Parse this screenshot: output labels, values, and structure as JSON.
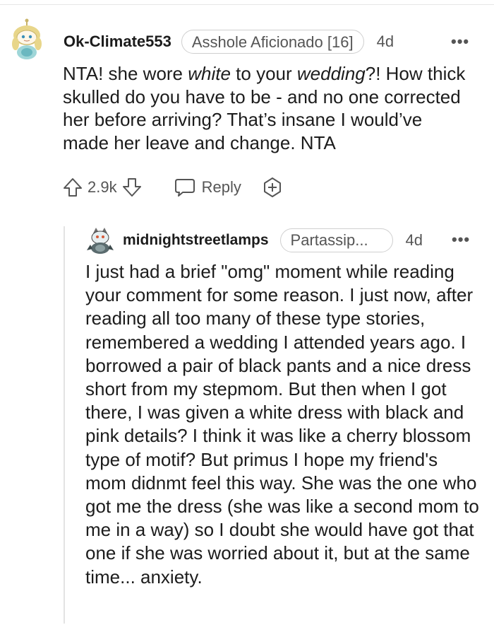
{
  "parent_comment": {
    "username": "Ok-Climate553",
    "flair": "Asshole Aficionado [16]",
    "age": "4d",
    "more_label": "•••",
    "body": {
      "p1": "NTA! she wore ",
      "em1": "white",
      "p2": " to your ",
      "em2": "wedding",
      "p3": "?! How thick skulled do you have to be - and no one corrected her before arriving? That’s insane I would’ve made her leave and change. NTA"
    },
    "score": "2.9k",
    "reply_label": "Reply"
  },
  "reply_comment": {
    "username": "midnightstreetlamps",
    "flair": "Partassip...",
    "age": "4d",
    "more_label": "•••",
    "body": "I just had a brief \"omg\" moment while reading your comment for some reason. I just now, after reading all too many of these type stories, remembered a wedding I attended years ago. I borrowed a pair of black pants and a nice dress short from my stepmom. But then when I got there, I was given a white dress with black and pink details? I think it was like a cherry blossom type of motif? But primus I hope my friend's mom didnmt feel this way. She was the one who got me the dress (she was like a second mom to me in a way) so I doubt she would have got that one if she was worried about it, but at the same time... anxiety."
  },
  "icons": {
    "upvote": "upvote-arrow-icon",
    "downvote": "downvote-arrow-icon",
    "reply": "speech-bubble-icon",
    "award": "award-plus-icon"
  },
  "colors": {
    "text": "#1c1c1c",
    "meta": "#555555",
    "divider": "#e3e3e3"
  }
}
